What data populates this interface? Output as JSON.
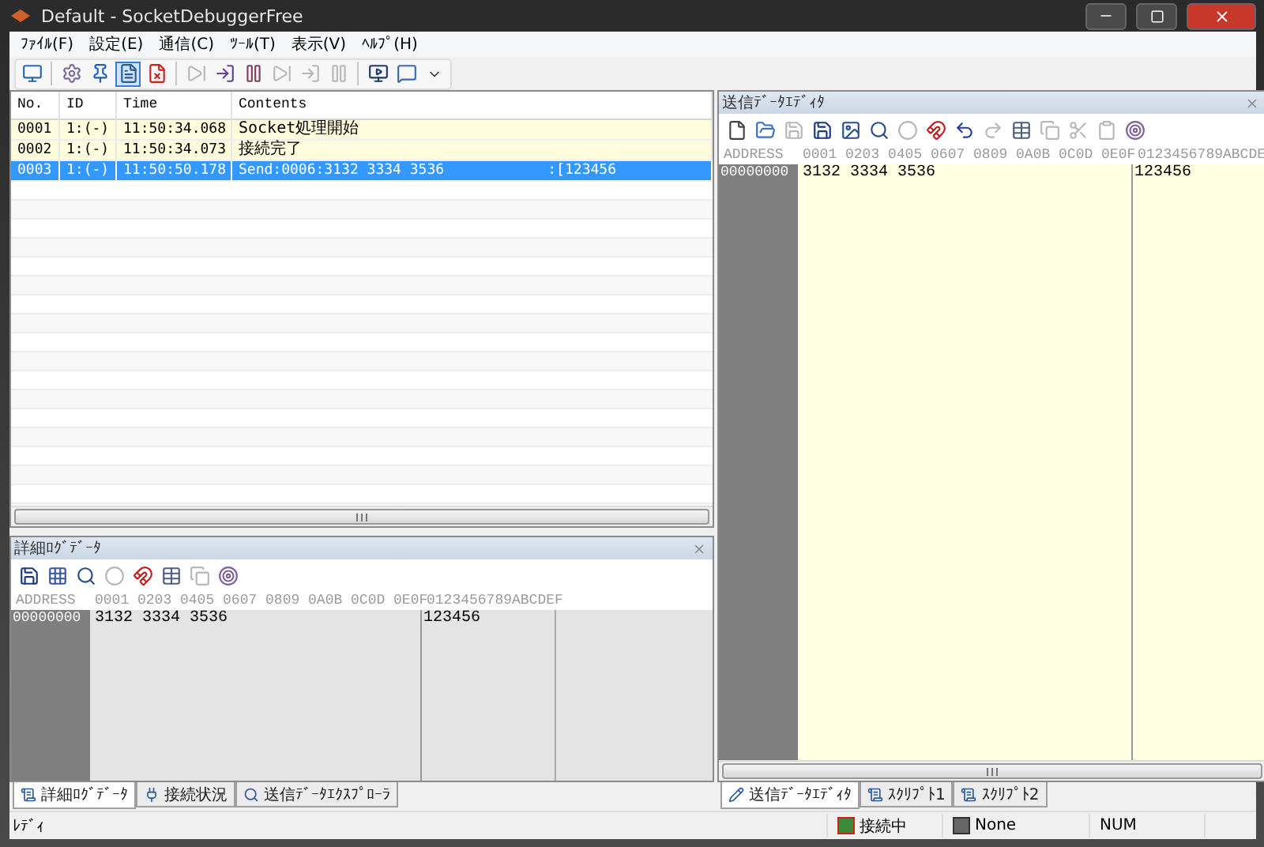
{
  "window": {
    "title": "Default - SocketDebuggerFree"
  },
  "menu": [
    "ﾌｧｲﾙ(F)",
    "設定(E)",
    "通信(C)",
    "ﾂｰﾙ(T)",
    "表示(V)",
    "ﾍﾙﾌﾟ(H)"
  ],
  "toolbar": [
    {
      "buttons": [
        {
          "kind": "monitor",
          "disabled": false,
          "on": false
        }
      ]
    },
    {
      "buttons": [
        {
          "kind": "settings",
          "disabled": false,
          "on": false
        },
        {
          "kind": "pin",
          "disabled": false,
          "on": false
        },
        {
          "kind": "document",
          "disabled": false,
          "on": true
        },
        {
          "kind": "delete",
          "disabled": false,
          "on": false
        }
      ]
    },
    {
      "buttons": [
        {
          "kind": "step",
          "disabled": true,
          "on": false
        },
        {
          "kind": "step-in",
          "disabled": false,
          "on": false
        },
        {
          "kind": "pause",
          "disabled": false,
          "on": false
        },
        {
          "kind": "step",
          "disabled": true,
          "on": false
        },
        {
          "kind": "step-in",
          "disabled": true,
          "on": false
        },
        {
          "kind": "pause",
          "disabled": true,
          "on": false
        }
      ]
    },
    {
      "buttons": [
        {
          "kind": "screen",
          "disabled": false,
          "on": false
        },
        {
          "kind": "comment",
          "disabled": false,
          "on": false
        }
      ]
    }
  ],
  "log": {
    "columns": [
      "No.",
      "ID",
      "Time",
      "Contents"
    ],
    "rows": [
      {
        "cells": [
          "0001",
          "1:(-)",
          "11:50:34.068",
          "Socket処理開始"
        ],
        "selected": false
      },
      {
        "cells": [
          "0002",
          "1:(-)",
          "11:50:34.073",
          "接続完了"
        ],
        "selected": false
      },
      {
        "cells": [
          "0003",
          "1:(-)",
          "11:50:50.178",
          "Send:0006:3132 3334 3536"
        ],
        "ascii": ":[123456",
        "selected": true
      }
    ]
  },
  "detail": {
    "title": "詳細ﾛｸﾞﾃﾞｰﾀ",
    "toolbar": [
      {
        "kind": "save",
        "disabled": false
      },
      {
        "kind": "grid",
        "disabled": false
      },
      {
        "kind": "search",
        "disabled": false
      },
      {
        "kind": "circle",
        "disabled": true
      },
      {
        "kind": "magnet",
        "disabled": false
      },
      {
        "kind": "table",
        "disabled": false
      },
      {
        "kind": "copy",
        "disabled": true
      },
      {
        "kind": "target",
        "disabled": false
      }
    ],
    "hex": {
      "address_header": "ADDRESS",
      "hex_header": "0001 0203 0405 0607 0809 0A0B 0C0D 0E0F",
      "ascii_header": "0123456789ABCDEF",
      "rows": [
        {
          "address": "00000000",
          "hex": "3132 3334 3536",
          "ascii": "123456"
        }
      ]
    }
  },
  "left_tabs": [
    {
      "label": "詳細ﾛｸﾞﾃﾞｰﾀ",
      "selected": true
    },
    {
      "label": "接続状況",
      "selected": false
    },
    {
      "label": "送信ﾃﾞｰﾀｴｸｽﾌﾟﾛｰﾗ",
      "selected": false
    }
  ],
  "editor": {
    "title": "送信ﾃﾞｰﾀｴﾃﾞｨﾀ",
    "toolbar": [
      {
        "kind": "new",
        "disabled": false
      },
      {
        "kind": "folder",
        "disabled": false
      },
      {
        "kind": "save",
        "disabled": true
      },
      {
        "kind": "save",
        "disabled": false
      },
      {
        "kind": "image",
        "disabled": false
      },
      {
        "kind": "search",
        "disabled": false
      },
      {
        "kind": "circle",
        "disabled": true
      },
      {
        "kind": "magnet",
        "disabled": false
      },
      {
        "kind": "undo",
        "disabled": false
      },
      {
        "kind": "redo",
        "disabled": true
      },
      {
        "kind": "table",
        "disabled": false
      },
      {
        "kind": "copy",
        "disabled": true
      },
      {
        "kind": "cut",
        "disabled": true
      },
      {
        "kind": "paste",
        "disabled": true
      },
      {
        "kind": "target",
        "disabled": false
      }
    ],
    "hex": {
      "address_header": "ADDRESS",
      "hex_header": "0001 0203 0405 0607 0809 0A0B 0C0D 0E0F",
      "ascii_header": "0123456789ABCDE",
      "rows": [
        {
          "address": "00000000",
          "hex": "3132 3334 3536",
          "ascii": "123456"
        }
      ]
    }
  },
  "right_tabs": [
    {
      "label": "送信ﾃﾞｰﾀｴﾃﾞｨﾀ",
      "selected": true
    },
    {
      "label": "ｽｸﾘﾌﾟﾄ1",
      "selected": false
    },
    {
      "label": "ｽｸﾘﾌﾟﾄ2",
      "selected": false
    }
  ],
  "status_bar": {
    "message": "ﾚﾃﾞｨ",
    "connection": "接続中",
    "script": "None",
    "num": "NUM"
  }
}
